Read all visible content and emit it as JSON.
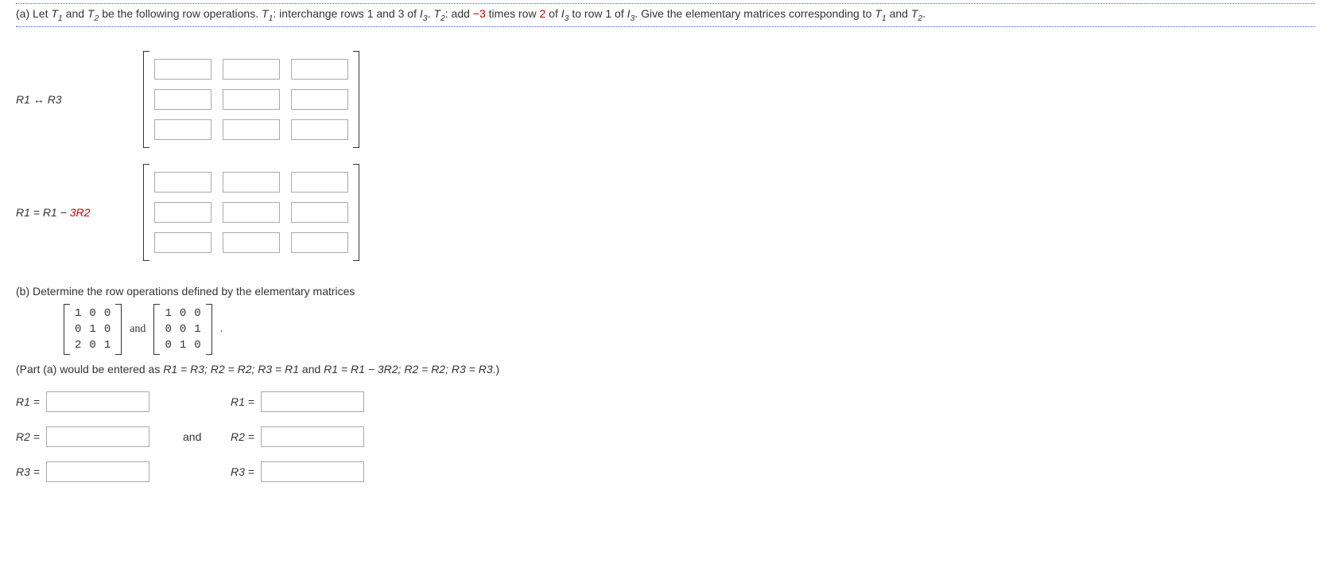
{
  "partA": {
    "prefix": "(a) Let ",
    "t1": "T",
    "t1sub": "1",
    "and1": " and ",
    "t2": "T",
    "t2sub": "2",
    "mid1": " be the following row operations. ",
    "t1b": "T",
    "t1bsub": "1",
    "op1": ": interchange rows 1 and 3 of ",
    "i3a": "I",
    "i3asub": "3",
    "period1": ". ",
    "t2b": "T",
    "t2bsub": "2",
    "op2a": ": add ",
    "neg3": "−3",
    "op2b": " times row ",
    "two": "2",
    "op2c": " of ",
    "i3b": "I",
    "i3bsub": "3",
    "op2d": " to row 1 of ",
    "i3c": "I",
    "i3csub": "3",
    "tail": ". Give the elementary matrices corresponding to ",
    "t1c": "T",
    "t1csub": "1",
    "and2": " and ",
    "t2c": "T",
    "t2csub": "2",
    "end": "."
  },
  "labels": {
    "op1_a": "R1",
    "op1_arrow": " ↔ ",
    "op1_b": "R3",
    "op2_a": "R1",
    "op2_eq": " = ",
    "op2_b": "R1",
    "op2_minus": " − ",
    "op2_c": "3R2"
  },
  "partB": {
    "intro": "(b) Determine the row operations defined by the elementary matrices",
    "and": "and",
    "period": ".",
    "m1": [
      [
        "1",
        "0",
        "0"
      ],
      [
        "0",
        "1",
        "0"
      ],
      [
        "2",
        "0",
        "1"
      ]
    ],
    "m2": [
      [
        "1",
        "0",
        "0"
      ],
      [
        "0",
        "0",
        "1"
      ],
      [
        "0",
        "1",
        "0"
      ]
    ],
    "hint_a": "(Part (a) would be entered as  ",
    "hint_b": "R1 = R3; R2 = R2; R3 = R1",
    "hint_c": " and ",
    "hint_d": "R1 = R1 − 3R2; R2 = R2; R3 = R3",
    "hint_e": ".)"
  },
  "answers": {
    "r1": "R1 =",
    "r2": "R2 =",
    "r3": "R3 =",
    "and": "and"
  }
}
